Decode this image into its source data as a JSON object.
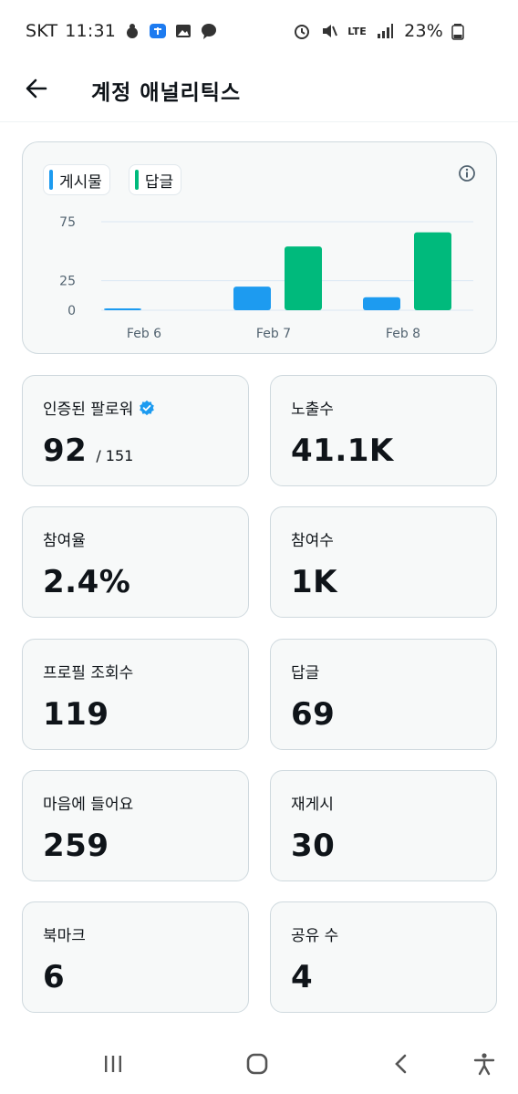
{
  "status_bar": {
    "carrier": "SKT",
    "time": "11:31",
    "network": "LTE",
    "battery": "23%"
  },
  "header": {
    "title": "계정 애널리틱스"
  },
  "chart_data": {
    "type": "bar",
    "categories": [
      "Feb 6",
      "Feb 7",
      "Feb 8"
    ],
    "series": [
      {
        "name": "게시물",
        "values": [
          1,
          20,
          11
        ]
      },
      {
        "name": "답글",
        "values": [
          0,
          54,
          66
        ]
      }
    ],
    "y_ticks": [
      "0",
      "25",
      "75"
    ],
    "ylim": [
      0,
      75
    ],
    "grid": true,
    "legend_position": "top-left",
    "colors": {
      "게시물": "#1d9bf0",
      "답글": "#00ba7c"
    }
  },
  "stats": [
    {
      "label": "인증된 팔로워",
      "value": "92",
      "sub": "/ 151"
    },
    {
      "label": "노출수",
      "value": "41.1K"
    },
    {
      "label": "참여율",
      "value": "2.4%"
    },
    {
      "label": "참여수",
      "value": "1K"
    },
    {
      "label": "프로필 조회수",
      "value": "119"
    },
    {
      "label": "답글",
      "value": "69"
    },
    {
      "label": "마음에 들어요",
      "value": "259"
    },
    {
      "label": "재게시",
      "value": "30"
    },
    {
      "label": "북마크",
      "value": "6"
    },
    {
      "label": "공유 수",
      "value": "4"
    }
  ],
  "icons": {
    "back": "arrow-left-icon",
    "info": "info-icon",
    "verified": "verified-badge-icon"
  }
}
